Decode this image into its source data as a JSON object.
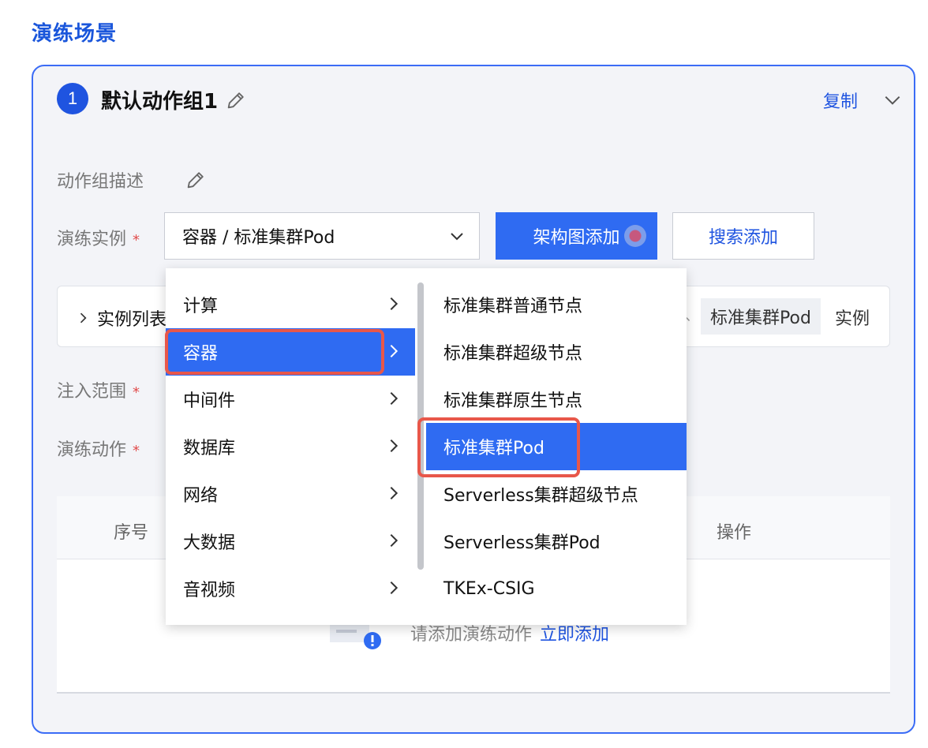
{
  "page": {
    "title": "演练场景"
  },
  "group": {
    "step_number": "1",
    "name": "默认动作组1",
    "copy_label": "复制"
  },
  "form": {
    "description_label": "动作组描述",
    "instance_label": "演练实例",
    "scope_label": "注入范围",
    "action_label": "演练动作",
    "required_mark": "*",
    "instance_select_value": "容器 / 标准集群Pod",
    "arch_add_label": "架构图添加",
    "search_add_label": "搜索添加"
  },
  "instance_bar": {
    "expander_label": "实例列表",
    "tag_prefix": "、",
    "tag": "标准集群Pod",
    "tag_suffix": "实例"
  },
  "table": {
    "columns": [
      "序号",
      "操作"
    ],
    "empty_text": "请添加演练动作",
    "empty_link": "立即添加"
  },
  "cascader": {
    "level1": [
      {
        "label": "计算",
        "active": false
      },
      {
        "label": "容器",
        "active": true
      },
      {
        "label": "中间件",
        "active": false
      },
      {
        "label": "数据库",
        "active": false
      },
      {
        "label": "网络",
        "active": false
      },
      {
        "label": "大数据",
        "active": false
      },
      {
        "label": "音视频",
        "active": false
      }
    ],
    "level2": [
      {
        "label": "标准集群普通节点",
        "active": false
      },
      {
        "label": "标准集群超级节点",
        "active": false
      },
      {
        "label": "标准集群原生节点",
        "active": false
      },
      {
        "label": "标准集群Pod",
        "active": true
      },
      {
        "label": "Serverless集群超级节点",
        "active": false
      },
      {
        "label": "Serverless集群Pod",
        "active": false
      },
      {
        "label": "TKEx-CSIG",
        "active": false
      }
    ]
  },
  "colors": {
    "accent": "#1f54e0",
    "active_bg": "#2f6bf2",
    "highlight": "#e8574a",
    "required": "#e14c4c"
  },
  "icons": [
    "pencil-icon",
    "chevron-down-icon",
    "chevron-right-icon",
    "empty-state-icon"
  ]
}
